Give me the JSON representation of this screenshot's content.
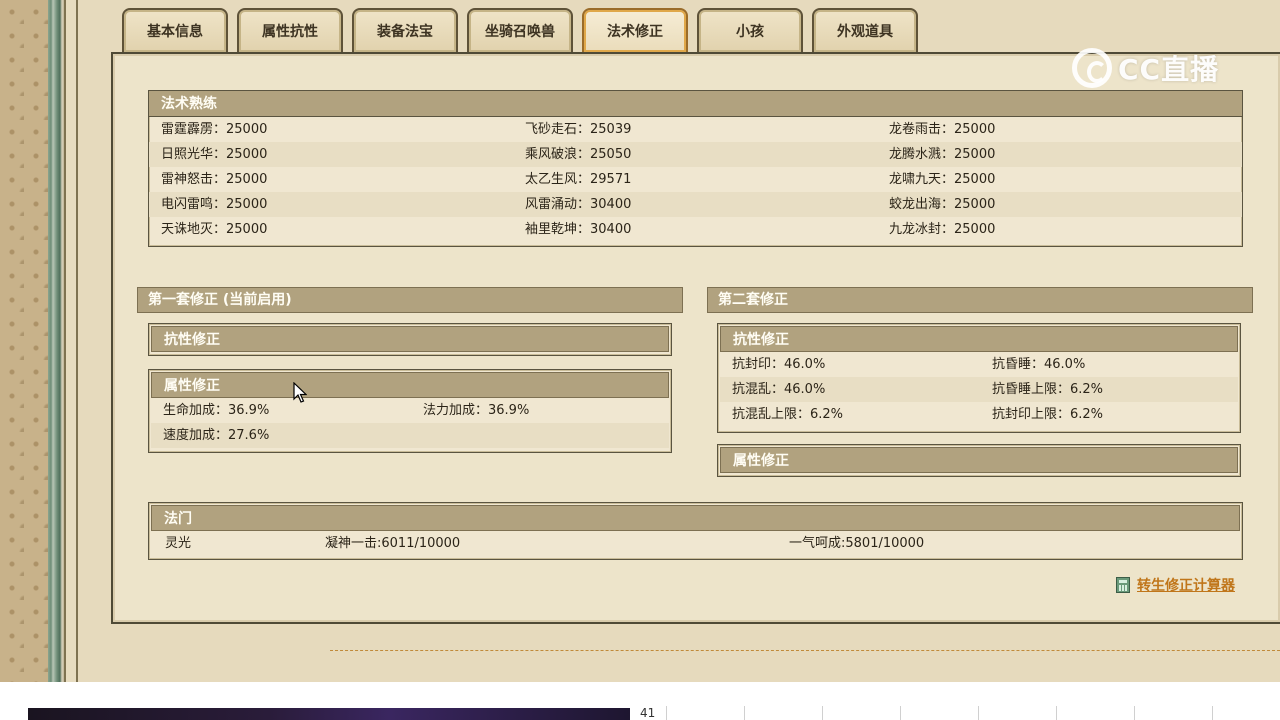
{
  "tabs": [
    {
      "label": "基本信息",
      "active": false
    },
    {
      "label": "属性抗性",
      "active": false
    },
    {
      "label": "装备法宝",
      "active": false
    },
    {
      "label": "坐骑召唤兽",
      "active": false
    },
    {
      "label": "法术修正",
      "active": true
    },
    {
      "label": "小孩",
      "active": false
    },
    {
      "label": "外观道具",
      "active": false
    }
  ],
  "watermark": {
    "text": "CC直播"
  },
  "spell_mastery": {
    "title": "法术熟练",
    "rows": [
      [
        "雷霆霹雳：25000",
        "飞砂走石：25039",
        "龙卷雨击：25000"
      ],
      [
        "日照光华：25000",
        "乘风破浪：25050",
        "龙腾水溅：25000"
      ],
      [
        "雷神怒击：25000",
        "太乙生风：29571",
        "龙啸九天：25000"
      ],
      [
        "电闪雷鸣：25000",
        "风雷涌动：30400",
        "蛟龙出海：25000"
      ],
      [
        "天诛地灭：25000",
        "袖里乾坤：30400",
        "九龙冰封：25000"
      ]
    ]
  },
  "set1": {
    "title": "第一套修正 (当前启用)",
    "resist_title": "抗性修正",
    "attr_title": "属性修正",
    "attr_rows": [
      [
        "生命加成：36.9%",
        "法力加成：36.9%"
      ],
      [
        "速度加成：27.6%",
        ""
      ]
    ]
  },
  "set2": {
    "title": "第二套修正",
    "resist_title": "抗性修正",
    "resist_rows": [
      [
        "抗封印：46.0%",
        "抗昏睡：46.0%"
      ],
      [
        "抗混乱：46.0%",
        "抗昏睡上限：6.2%"
      ],
      [
        "抗混乱上限：6.2%",
        "抗封印上限：6.2%"
      ]
    ],
    "attr_title": "属性修正"
  },
  "famen": {
    "title": "法门",
    "name": "灵光",
    "skill1": "凝神一击:6011/10000",
    "skill2": "一气呵成:5801/10000"
  },
  "calculator_link": "转生修正计算器",
  "page_number": "41"
}
